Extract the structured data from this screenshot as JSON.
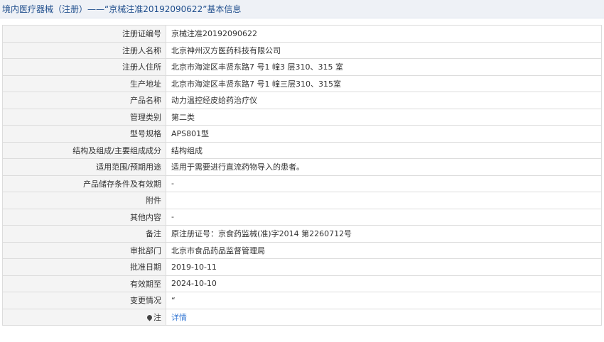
{
  "title": "境内医疗器械（注册）——“京械注准20192090622”基本信息",
  "rows": [
    {
      "label": "注册证编号",
      "value": "京械注准20192090622"
    },
    {
      "label": "注册人名称",
      "value": "北京神州汉方医药科技有限公司"
    },
    {
      "label": "注册人住所",
      "value": "北京市海淀区丰贤东路7 号1 幢3 层310、315 室"
    },
    {
      "label": "生产地址",
      "value": "北京市海淀区丰贤东路7 号1 幢三层310、315室"
    },
    {
      "label": "产品名称",
      "value": "动力温控经皮给药治疗仪"
    },
    {
      "label": "管理类别",
      "value": "第二类"
    },
    {
      "label": "型号规格",
      "value": "APS801型"
    },
    {
      "label": "结构及组成/主要组成成分",
      "value": "结构组成"
    },
    {
      "label": "适用范围/预期用途",
      "value": "适用于需要进行直流药物导入的患者。"
    },
    {
      "label": "产品储存条件及有效期",
      "value": "-"
    },
    {
      "label": "附件",
      "value": ""
    },
    {
      "label": "其他内容",
      "value": "-"
    },
    {
      "label": "备注",
      "value": "原注册证号：京食药监械(准)字2014 第2260712号"
    },
    {
      "label": "审批部门",
      "value": "北京市食品药品监督管理局"
    },
    {
      "label": "批准日期",
      "value": "2019-10-11"
    },
    {
      "label": "有效期至",
      "value": "2024-10-10"
    },
    {
      "label": "变更情况",
      "value": "“"
    }
  ],
  "note_row": {
    "label": "注",
    "icon": "pin-icon",
    "link_text": "详情",
    "link_color": "#3a7bd5"
  },
  "colors": {
    "title_bar_bg": "#eef1f6",
    "title_text": "#1e4d8c",
    "label_bg": "#f4f4f4",
    "border": "#dcdcdc"
  }
}
